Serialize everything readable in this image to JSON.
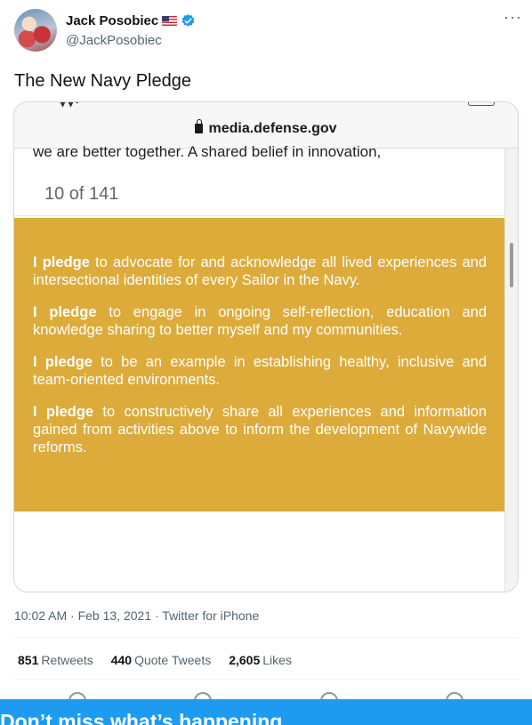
{
  "author": {
    "display_name": "Jack Posobiec",
    "handle": "@JackPosobiec",
    "badges": [
      "us-flag-icon",
      "verified-icon"
    ]
  },
  "tweet": {
    "text": "The New Navy Pledge",
    "timestamp": "10:02 AM · Feb 13, 2021 · Twitter for iPhone"
  },
  "media": {
    "browser_url": "media.defense.gov",
    "cut_off_text": "we are better together. A shared belief in innovation,",
    "page_counter": "10 of 141",
    "pledge_color": "#dcab3a",
    "pledges": [
      {
        "lead": "I pledge",
        "text": " to advocate for and acknowledge all lived experiences and intersectional identities of every Sailor in the Navy."
      },
      {
        "lead": "I pledge",
        "text": " to engage in ongoing self-reflection, education and knowledge sharing to better myself and my communities."
      },
      {
        "lead": "I pledge",
        "text": " to be an example in establishing healthy, inclusive and team-oriented environments."
      },
      {
        "lead": "I pledge",
        "text": " to constructively share all experiences and information gained from activities above to inform the development of Navywide reforms."
      }
    ]
  },
  "stats": {
    "retweets_count": "851",
    "retweets_label": "Retweets",
    "quotes_count": "440",
    "quotes_label": "Quote Tweets",
    "likes_count": "2,605",
    "likes_label": "Likes"
  },
  "banner": {
    "text": "Don’t miss what’s happening",
    "color": "#1d9bf0"
  }
}
